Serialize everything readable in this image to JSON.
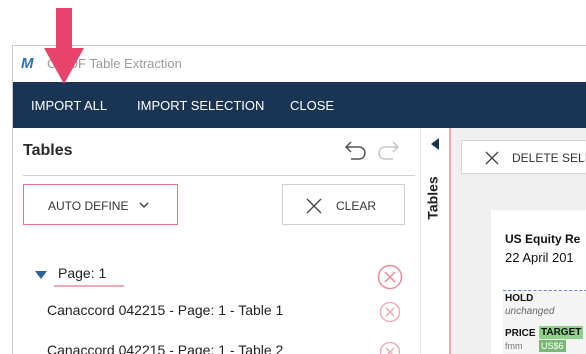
{
  "window": {
    "title": "C PDF Table Extraction"
  },
  "menu": {
    "items": [
      "IMPORT ALL",
      "IMPORT SELECTION",
      "CLOSE"
    ]
  },
  "left_panel": {
    "title": "Tables",
    "auto_define_label": "AUTO DEFINE",
    "clear_label": "CLEAR",
    "page_label": "Page:  1",
    "tables": [
      "Canaccord 042215 - Page: 1 - Table 1",
      "Canaccord 042215 - Page: 1 - Table 2"
    ]
  },
  "side_tab": {
    "label": "Tables"
  },
  "right_panel": {
    "delete_label": "DELETE SELI",
    "document": {
      "heading": "US Equity Re",
      "date": "22 April 201",
      "hold": "HOLD",
      "unchanged": "unchanged",
      "price": "PRICE",
      "target": "TARGET",
      "fm": "fmm",
      "usd": "US$6"
    }
  },
  "colors": {
    "menubar": "#1a3553",
    "accent_pink": "#e3728a",
    "arrow_red": "#e8436a",
    "highlight_green": "#8fd08a"
  }
}
